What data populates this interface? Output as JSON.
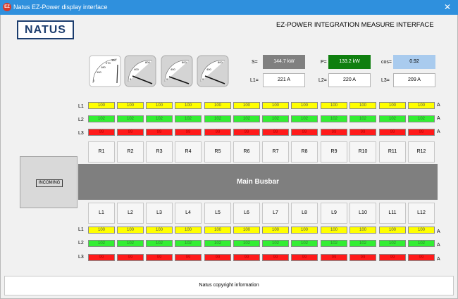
{
  "window": {
    "title": "Natus EZ-Power display interface",
    "close_glyph": "✕",
    "icon_text": "EZ"
  },
  "header": {
    "logo": "NATUS",
    "heading": "EZ-POWER INTEGRATION MEASURE INTERFACE"
  },
  "gauges": [
    {
      "ticks": [
        "0",
        "100",
        "180",
        "270",
        "360"
      ],
      "needle_fraction": 0.15
    },
    {
      "ticks": [
        "0",
        "400",
        "800"
      ],
      "needle_fraction": 0.12
    },
    {
      "ticks": [
        "0",
        "400",
        "800"
      ],
      "needle_fraction": 0.1
    },
    {
      "ticks": [
        "0",
        "400",
        "800"
      ],
      "needle_fraction": 0.12
    }
  ],
  "readouts": {
    "s_label": "S=",
    "s_value": "144.7 kW",
    "p_label": "P=",
    "p_value": "133.2 kW",
    "cos_label": "cos=",
    "cos_value": "0.92",
    "l1_label": "L1=",
    "l1_value": "221 A",
    "l2_label": "L2=",
    "l2_value": "220 A",
    "l3_label": "L3=",
    "l3_value": "209 A",
    "colors": {
      "s": "#808080",
      "p": "#0f7f0f",
      "cos": "#a9cbee"
    }
  },
  "top_rows": {
    "labels": [
      "L1",
      "L2",
      "L3"
    ],
    "unit": "A",
    "l1": [
      "100",
      "100",
      "100",
      "100",
      "100",
      "100",
      "100",
      "100",
      "100",
      "100",
      "100",
      "100"
    ],
    "l2": [
      "102",
      "102",
      "102",
      "102",
      "102",
      "102",
      "102",
      "102",
      "102",
      "102",
      "102",
      "102"
    ],
    "l3": [
      "99",
      "99",
      "99",
      "99",
      "99",
      "99",
      "99",
      "99",
      "99",
      "99",
      "99",
      "99"
    ]
  },
  "r_feeders": [
    "R1",
    "R2",
    "R3",
    "R4",
    "R5",
    "R6",
    "R7",
    "R8",
    "R9",
    "R10",
    "R11",
    "R12"
  ],
  "incoming": {
    "label": "INCOMING"
  },
  "busbar": {
    "label": "Main Busbar"
  },
  "l_feeders": [
    "L1",
    "L2",
    "L3",
    "L4",
    "L5",
    "L6",
    "L7",
    "L8",
    "L9",
    "L10",
    "L11",
    "L12"
  ],
  "bottom_rows": {
    "labels": [
      "L1",
      "L2",
      "L3"
    ],
    "unit": "A",
    "l1": [
      "100",
      "100",
      "100",
      "100",
      "100",
      "100",
      "100",
      "100",
      "100",
      "100",
      "100",
      "100"
    ],
    "l2": [
      "102",
      "102",
      "102",
      "102",
      "102",
      "102",
      "102",
      "102",
      "102",
      "102",
      "102",
      "102"
    ],
    "l3": [
      "99",
      "99",
      "99",
      "99",
      "99",
      "99",
      "99",
      "99",
      "99",
      "99",
      "99",
      "99"
    ]
  },
  "footer": {
    "text": "Natus copyright information"
  },
  "colors": {
    "titlebar": "#2f90dd",
    "phase_l1": "#ffff00",
    "phase_l2": "#33ee33",
    "phase_l3": "#ff1a1a",
    "busbar": "#7f7f7f"
  }
}
